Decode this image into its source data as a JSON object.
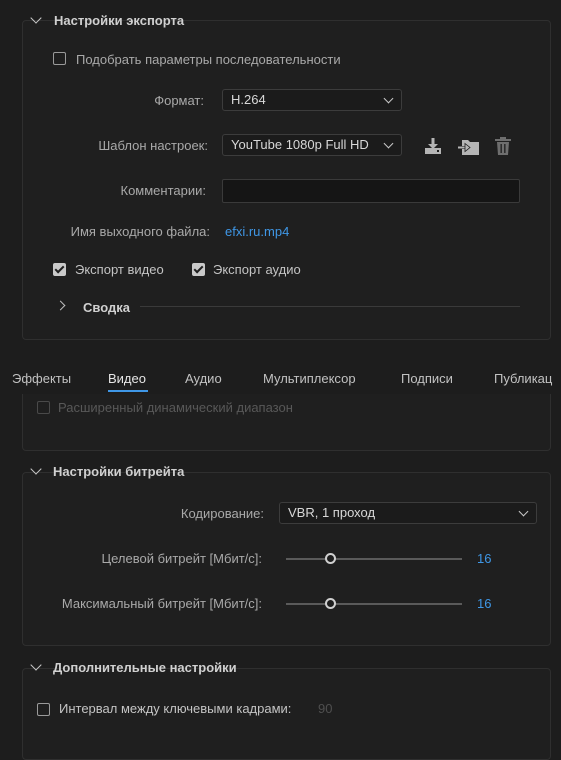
{
  "export_settings": {
    "title": "Настройки экспорта",
    "match_sequence_label": "Подобрать параметры последовательности",
    "format_label": "Формат:",
    "format_value": "H.264",
    "preset_label": "Шаблон настроек:",
    "preset_value": "YouTube 1080p Full HD",
    "comments_label": "Комментарии:",
    "comments_value": "",
    "output_name_label": "Имя выходного файла:",
    "output_name_value": "efxi.ru.mp4",
    "export_video_label": "Экспорт видео",
    "export_video_checked": true,
    "export_audio_label": "Экспорт аудио",
    "export_audio_checked": true,
    "summary_label": "Сводка",
    "icons": [
      "save-preset-icon",
      "import-preset-icon",
      "delete-preset-icon"
    ]
  },
  "tabs": [
    {
      "label": "Эффекты",
      "active": false
    },
    {
      "label": "Видео",
      "active": true
    },
    {
      "label": "Аудио",
      "active": false
    },
    {
      "label": "Мультиплексор",
      "active": false
    },
    {
      "label": "Подписи",
      "active": false
    },
    {
      "label": "Публикац",
      "active": false
    }
  ],
  "hdr": {
    "label": "Расширенный динамический диапазон",
    "checked": false,
    "disabled": true
  },
  "bitrate": {
    "title": "Настройки битрейта",
    "encoding_label": "Кодирование:",
    "encoding_value": "VBR, 1 проход",
    "target_label": "Целевой битрейт [Мбит/с]:",
    "target_value": "16",
    "max_label": "Максимальный битрейт [Мбит/с]:",
    "max_value": "16"
  },
  "advanced": {
    "title": "Дополнительные настройки",
    "keyframe_label": "Интервал между ключевыми кадрами:",
    "keyframe_value": "90",
    "keyframe_checked": false
  },
  "colors": {
    "accent": "#3f97e6",
    "background": "#1d1d1d",
    "panel": "#1f1f1f"
  }
}
